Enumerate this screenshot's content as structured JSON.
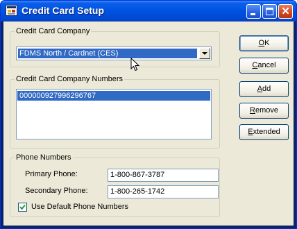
{
  "window": {
    "title": "Credit Card Setup"
  },
  "company_group": {
    "label": "Credit Card Company",
    "selected": "FDMS North / Cardnet (CES)"
  },
  "numbers_group": {
    "label": "Credit Card Company Numbers",
    "items": [
      "000000927996296767"
    ]
  },
  "phone_group": {
    "label": "Phone Numbers",
    "primary_label": "Primary Phone:",
    "primary_value": "1-800-867-3787",
    "secondary_label": "Secondary Phone:",
    "secondary_value": "1-800-265-1742",
    "default_checkbox_label": "Use Default Phone Numbers",
    "default_checked": true
  },
  "buttons": {
    "ok": {
      "mnemonic": "O",
      "rest": "K"
    },
    "cancel": {
      "mnemonic": "C",
      "rest": "ancel"
    },
    "add": {
      "mnemonic": "A",
      "rest": "dd"
    },
    "remove": {
      "mnemonic": "R",
      "rest": "emove"
    },
    "extended": {
      "mnemonic": "E",
      "rest": "xtended"
    }
  },
  "icons": [
    "app-icon",
    "minimize-icon",
    "maximize-icon",
    "close-icon",
    "dropdown-arrow-icon",
    "checkmark-icon",
    "mouse-cursor-icon"
  ]
}
